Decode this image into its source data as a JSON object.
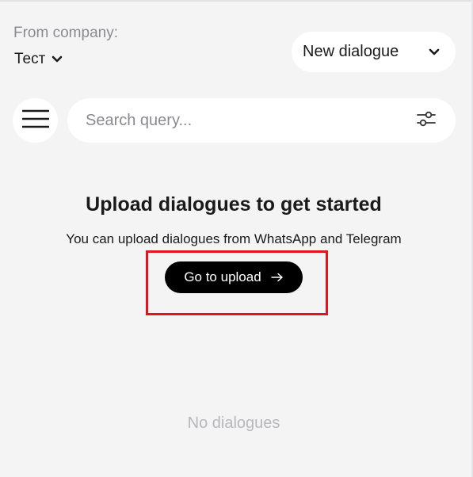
{
  "company": {
    "label": "From company:",
    "selected": "Тест",
    "dropdown_icon": "chevron-down-icon"
  },
  "new_dialogue": {
    "label": "New dialogue",
    "dropdown_icon": "chevron-down-icon"
  },
  "toolbar": {
    "menu_icon": "hamburger-menu-icon",
    "filter_icon": "sliders-icon"
  },
  "search": {
    "placeholder": "Search query...",
    "value": ""
  },
  "empty_state": {
    "title": "Upload dialogues to get started",
    "subtitle": "You can upload dialogues from WhatsApp and Telegram",
    "button_label": "Go to upload",
    "button_icon": "arrow-right-icon",
    "highlight_color": "#e0141e"
  },
  "list": {
    "empty_text": "No dialogues"
  },
  "colors": {
    "background": "#f4f4f5",
    "card": "#ffffff",
    "button": "#000000",
    "muted_text": "#8a8a90"
  }
}
